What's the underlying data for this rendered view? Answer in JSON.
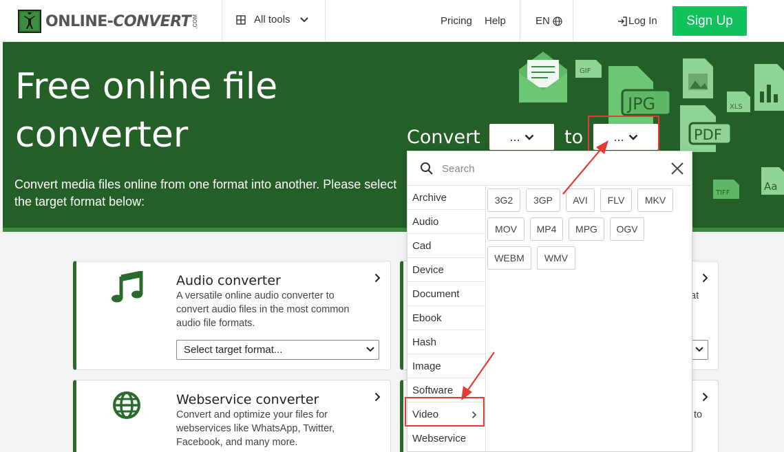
{
  "header": {
    "logo_text": "ONLINE-CONVERT",
    "logo_text_a": "ONLINE-",
    "logo_text_b": "CONVERT",
    "logo_suffix": ".COM",
    "all_tools_label": "All tools",
    "pricing_label": "Pricing",
    "help_label": "Help",
    "language_label": "EN",
    "login_label": "Log In",
    "signup_label": "Sign Up"
  },
  "hero": {
    "title": "Free online file converter",
    "description": "Convert media files online from one format into another. Please select the target format below:",
    "convert_label": "Convert",
    "to_label": "to",
    "from_value": "...",
    "to_value": "..."
  },
  "dropdown": {
    "search_placeholder": "Search",
    "categories": [
      "Archive",
      "Audio",
      "Cad",
      "Device",
      "Document",
      "Ebook",
      "Hash",
      "Image",
      "Software",
      "Video",
      "Webservice"
    ],
    "active_category": "Video",
    "formats": [
      "3G2",
      "3GP",
      "AVI",
      "FLV",
      "MKV",
      "MOV",
      "MP4",
      "MPG",
      "OGV",
      "WEBM",
      "WMV"
    ]
  },
  "cards": {
    "audio": {
      "title": "Audio converter",
      "description": "A versatile online audio converter to convert audio files in the most common audio file formats.",
      "select_placeholder": "Select target format..."
    },
    "webservice": {
      "title": "Webservice converter",
      "description": "Convert and optimize your files for webservices like WhatsApp, Twitter, Facebook, and many more."
    },
    "right_top_partial": "at",
    "right_bottom_partial": "to"
  },
  "colors": {
    "brand_green": "#245f27",
    "signup_green": "#11c15b",
    "annotation_red": "#e53935"
  },
  "hero_icons": {
    "jpg": "JPG",
    "pdf": "PDF",
    "gif": "GIF",
    "xls": "XLS",
    "tiff": "TIFF",
    "font": "Aa"
  }
}
